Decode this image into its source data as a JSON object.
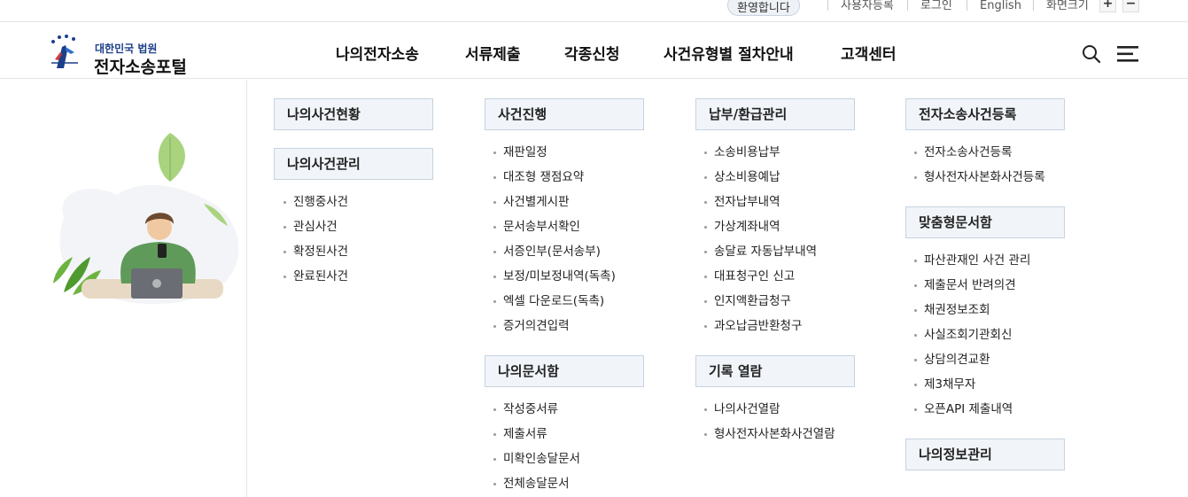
{
  "topbar": {
    "welcome": "환영합니다",
    "register": "사용자등록",
    "login": "로그인",
    "english": "English",
    "font_size": "화면크기",
    "font_plus": "+",
    "font_minus": "−"
  },
  "logo": {
    "top": "대한민국 법원",
    "main": "전자소송포털"
  },
  "gnb": [
    "나의전자소송",
    "서류제출",
    "각종신청",
    "사건유형별 절차안내",
    "고객센터"
  ],
  "menu": {
    "col1": {
      "cat1": "나의사건현황",
      "cat2": "나의사건관리",
      "items": [
        "진행중사건",
        "관심사건",
        "확정된사건",
        "완료된사건"
      ]
    },
    "col2": {
      "cat1": "사건진행",
      "items1": [
        "재판일정",
        "대조형 쟁점요약",
        "사건별게시판",
        "문서송부서확인",
        "서증인부(문서송부)",
        "보정/미보정내역(독촉)",
        "엑셀 다운로드(독촉)",
        "증거의견입력"
      ],
      "cat2": "나의문서함",
      "items2": [
        "작성중서류",
        "제출서류",
        "미확인송달문서",
        "전체송달문서"
      ]
    },
    "col3": {
      "cat1": "납부/환급관리",
      "items1": [
        "소송비용납부",
        "상소비용예납",
        "전자납부내역",
        "가상계좌내역",
        "송달료 자동납부내역",
        "대표청구인 신고",
        "인지액환급청구",
        "과오납금반환청구"
      ],
      "cat2": "기록 열람",
      "items2": [
        "나의사건열람",
        "형사전자사본화사건열람"
      ]
    },
    "col4": {
      "cat1": "전자소송사건등록",
      "items1": [
        "전자소송사건등록",
        "형사전자사본화사건등록"
      ],
      "cat2": "맞춤형문서함",
      "items2": [
        "파산관재인 사건 관리",
        "제출문서 반려의견",
        "채권정보조회",
        "사실조회기관회신",
        "상담의견교환",
        "제3채무자",
        "오픈API 제출내역"
      ],
      "cat3": "나의정보관리"
    }
  },
  "colors": {
    "brand_blue": "#1c3f8a",
    "category_bg": "#f1f5f9",
    "category_border": "#c6d2df",
    "leaf_green": "#8fc56a"
  }
}
